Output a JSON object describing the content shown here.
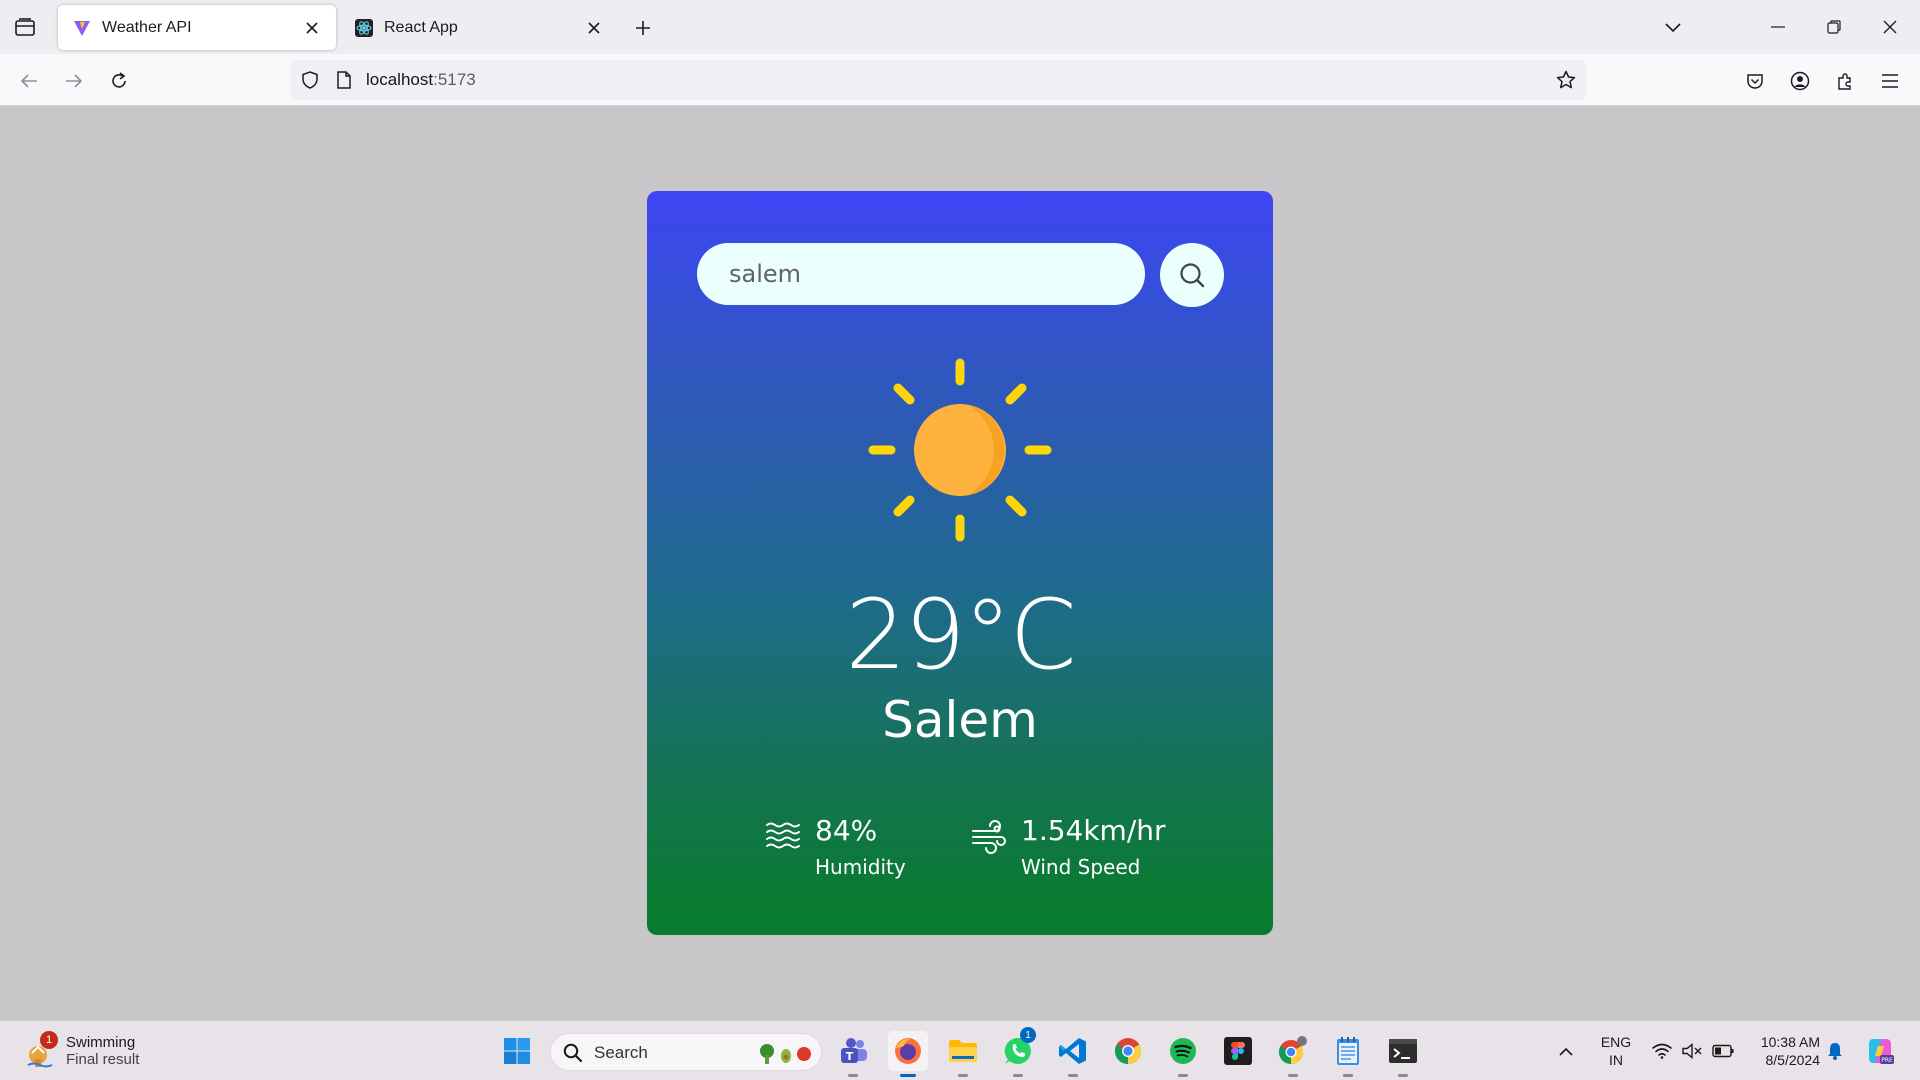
{
  "browser": {
    "tabs": [
      {
        "title": "Weather API",
        "active": true,
        "favicon": "vite-logo-icon"
      },
      {
        "title": "React App",
        "active": false,
        "favicon": "react-logo-icon"
      }
    ],
    "url": {
      "host": "localhost",
      "port": ":5173"
    }
  },
  "weather_app": {
    "search": {
      "value": "salem"
    },
    "icon": "sun-icon",
    "temperature": "29°C",
    "city": "Salem",
    "humidity": {
      "value": "84%",
      "label": "Humidity",
      "icon": "humidity-icon"
    },
    "wind": {
      "value": "1.54km/hr",
      "label": "Wind Speed",
      "icon": "wind-icon"
    }
  },
  "taskbar": {
    "widget": {
      "badge": "1",
      "title": "Swimming",
      "subtitle": "Final result"
    },
    "search_label": "Search",
    "whatsapp_badge": "1",
    "language": {
      "line1": "ENG",
      "line2": "IN"
    },
    "clock": {
      "time": "10:38 AM",
      "date": "8/5/2024"
    }
  },
  "colors": {
    "card_top": "#3d45f5",
    "card_bottom": "#067c2a",
    "input_bg": "#ebfffc",
    "sun": "#ffb23d",
    "sun_rays": "#ffd60a",
    "page_bg": "#c8c6c8"
  }
}
